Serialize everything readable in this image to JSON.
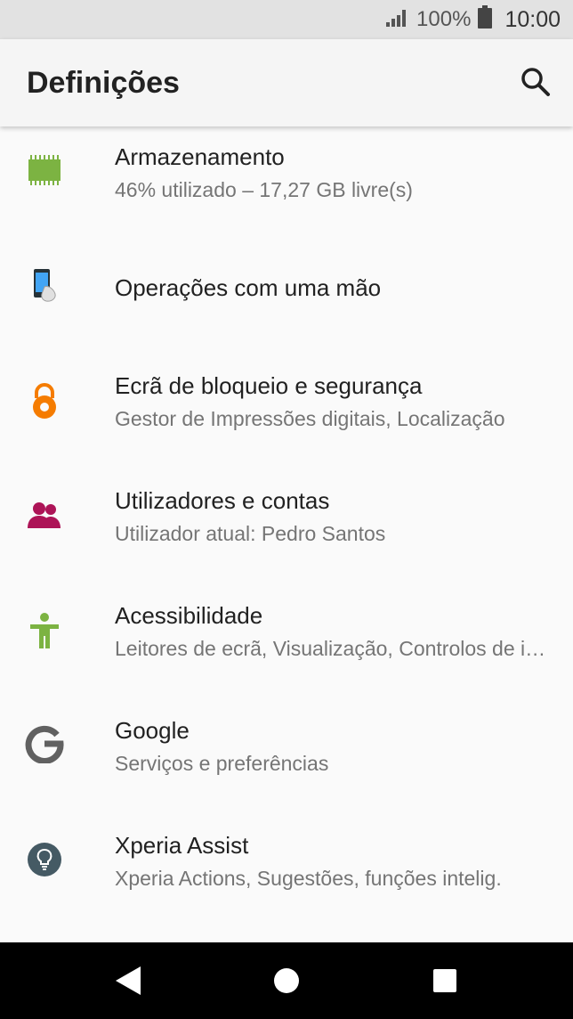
{
  "status_bar": {
    "signal_icon": "signal-icon",
    "battery_percent": "100%",
    "battery_icon": "battery-icon",
    "time": "10:00"
  },
  "app_bar": {
    "title": "Definições",
    "search_icon": "search-icon"
  },
  "items": [
    {
      "title": "Armazenamento",
      "subtitle": "46% utilizado – 17,27 GB livre(s)",
      "icon": "storage-chip-icon",
      "icon_color": "#7cb342"
    },
    {
      "title": "Operações com uma mão",
      "subtitle": "",
      "icon": "one-hand-phone-icon",
      "icon_color": "#1e88e5"
    },
    {
      "title": "Ecrã de bloqueio e segurança",
      "subtitle": "Gestor de Impressões digitais, Localização",
      "icon": "lock-icon",
      "icon_color": "#f57c00"
    },
    {
      "title": "Utilizadores e contas",
      "subtitle": "Utilizador atual: Pedro Santos",
      "icon": "users-icon",
      "icon_color": "#ad1457"
    },
    {
      "title": "Acessibilidade",
      "subtitle": "Leitores de ecrã, Visualização, Controlos de interação",
      "icon": "accessibility-icon",
      "icon_color": "#7cb342"
    },
    {
      "title": "Google",
      "subtitle": "Serviços e preferências",
      "icon": "google-icon",
      "icon_color": "#616161"
    },
    {
      "title": "Xperia Assist",
      "subtitle": "Xperia Actions, Sugestões, funções intelig.",
      "icon": "lightbulb-icon",
      "icon_color": "#455a64"
    }
  ],
  "nav_bar": {
    "back_icon": "back-icon",
    "home_icon": "home-icon",
    "recents_icon": "recents-icon"
  }
}
